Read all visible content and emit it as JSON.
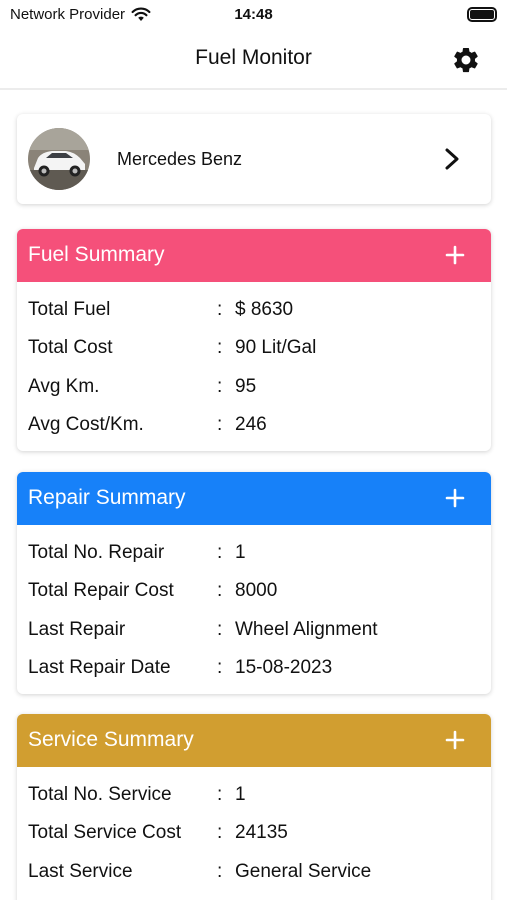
{
  "status": {
    "carrier": "Network Provider",
    "time": "14:48",
    "icons": [
      "wifi-icon",
      "battery-icon"
    ]
  },
  "nav": {
    "title": "Fuel Monitor",
    "settings_icon": "gear-icon"
  },
  "vehicle": {
    "name": "Mercedes Benz",
    "avatar": "car-photo",
    "chevron_icon": "chevron-right-icon"
  },
  "colors": {
    "fuel": "#f5507a",
    "repair": "#1781f9",
    "service": "#d19e30"
  },
  "fuel": {
    "title": "Fuel Summary",
    "rows": [
      {
        "label": "Total Fuel",
        "colon": ":",
        "value": "$ 8630"
      },
      {
        "label": "Total Cost",
        "colon": ":",
        "value": "90 Lit/Gal"
      },
      {
        "label": "Avg Km.",
        "colon": ":",
        "value": "95"
      },
      {
        "label": "Avg Cost/Km.",
        "colon": ":",
        "value": "246"
      }
    ]
  },
  "repair": {
    "title": "Repair Summary",
    "rows": [
      {
        "label": "Total No. Repair",
        "colon": ":",
        "value": "1"
      },
      {
        "label": "Total Repair Cost",
        "colon": ":",
        "value": "8000"
      },
      {
        "label": "Last Repair",
        "colon": ":",
        "value": "Wheel Alignment"
      },
      {
        "label": "Last Repair Date",
        "colon": ":",
        "value": "15-08-2023"
      }
    ]
  },
  "service": {
    "title": "Service Summary",
    "rows": [
      {
        "label": "Total No. Service",
        "colon": ":",
        "value": "1"
      },
      {
        "label": "Total Service Cost",
        "colon": ":",
        "value": "24135"
      },
      {
        "label": "Last Service",
        "colon": ":",
        "value": "General Service"
      }
    ]
  }
}
